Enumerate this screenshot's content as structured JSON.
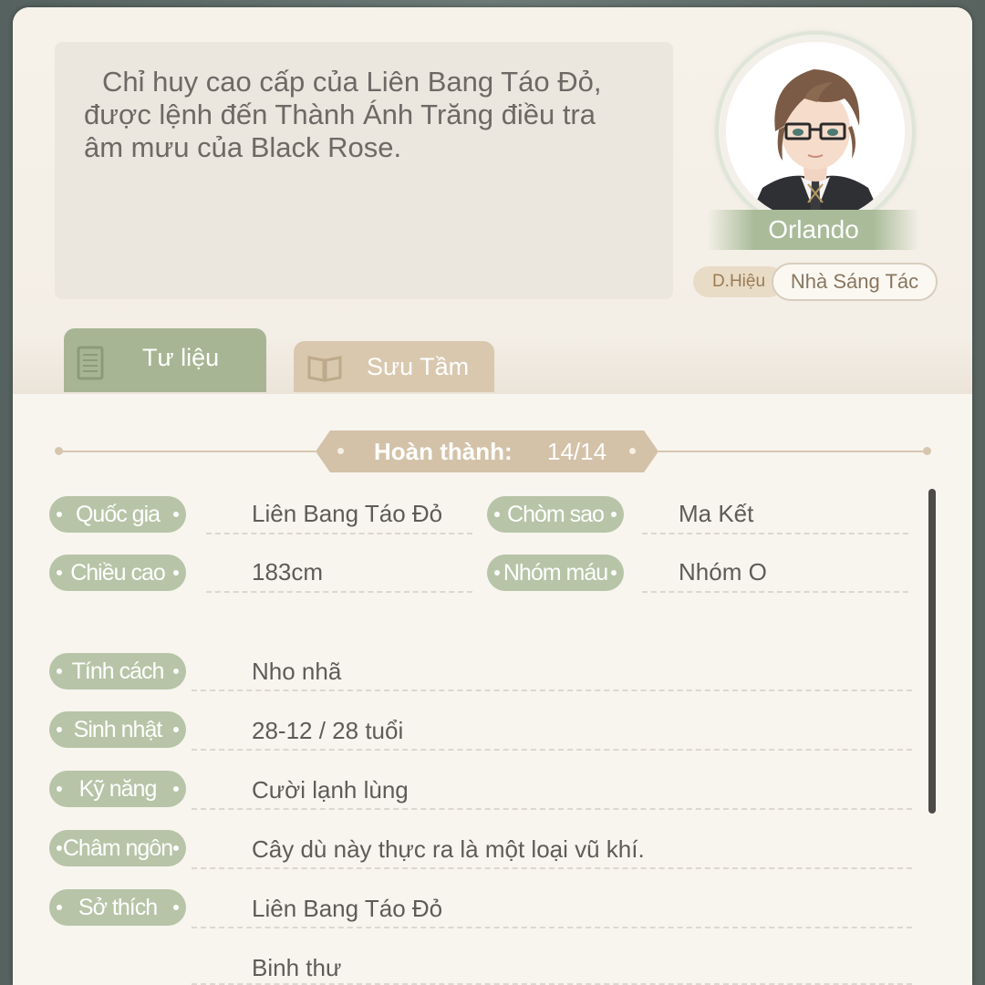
{
  "character": {
    "description": "Chỉ huy cao cấp của Liên Bang Táo Đỏ, được lệnh đến Thành Ánh Trăng điều tra âm mưu của Black Rose.",
    "name": "Orlando",
    "title_label": "D.Hiệu",
    "title_value": "Nhà Sáng Tác"
  },
  "tabs": [
    {
      "label": "Tư liệu",
      "active": true,
      "icon": "notebook-icon"
    },
    {
      "label": "Sưu Tầm",
      "active": false,
      "icon": "open-book-icon"
    }
  ],
  "progress": {
    "label": "Hoàn thành:",
    "value": "14/14"
  },
  "profile": {
    "country": {
      "label": "Quốc gia",
      "value": "Liên Bang Táo Đỏ"
    },
    "constellation": {
      "label": "Chòm sao",
      "value": "Ma Kết"
    },
    "height": {
      "label": "Chiều cao",
      "value": "183cm"
    },
    "blood_type": {
      "label": "Nhóm máu",
      "value": "Nhóm O"
    },
    "personality": {
      "label": "Tính cách",
      "value": "Nho nhã"
    },
    "birthday": {
      "label": "Sinh nhật",
      "value": "28-12 / 28 tuổi"
    },
    "skill": {
      "label": "Kỹ năng",
      "value": "Cười lạnh lùng"
    },
    "motto": {
      "label": "Châm ngôn",
      "value": "Cây dù này thực ra là một loại vũ khí."
    },
    "hobby": {
      "label": "Sở thích",
      "values": [
        "Liên Bang Táo Đỏ",
        "Binh thư"
      ]
    }
  },
  "colors": {
    "panel": "#f7f3ec",
    "accent_green": "#a7b594",
    "accent_tan": "#d3c2a8",
    "text": "#5f5b57"
  }
}
